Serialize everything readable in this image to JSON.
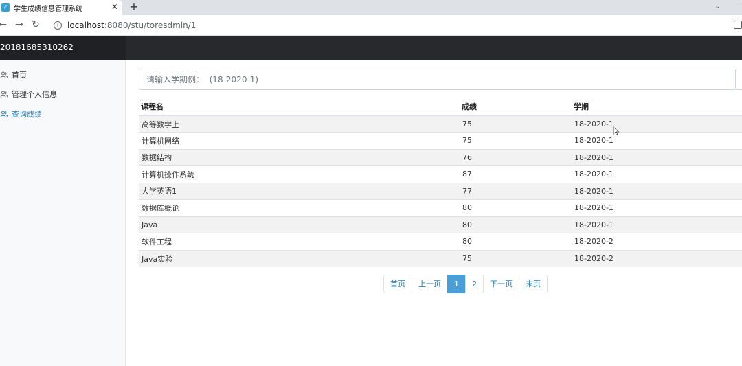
{
  "browser": {
    "tab_title": "学生成绩信息管理系统",
    "url_host": "localhost",
    "url_rest": ":8080/stu/toresdmin/1"
  },
  "app": {
    "brand": "20181685310262"
  },
  "sidebar": {
    "items": [
      {
        "label": "首页",
        "icon": "user-group-icon",
        "active": false
      },
      {
        "label": "管理个人信息",
        "icon": "user-group-icon",
        "active": false
      },
      {
        "label": "查询成绩",
        "icon": "user-group-icon",
        "active": true
      }
    ]
  },
  "search": {
    "placeholder": "请输入学期例：  (18-2020-1)"
  },
  "table": {
    "headers": [
      "课程名",
      "成绩",
      "学期"
    ],
    "rows": [
      [
        "高等数学上",
        "75",
        "18-2020-1"
      ],
      [
        "计算机网络",
        "75",
        "18-2020-1"
      ],
      [
        "数据结构",
        "76",
        "18-2020-1"
      ],
      [
        "计算机操作系统",
        "87",
        "18-2020-1"
      ],
      [
        "大学英语1",
        "77",
        "18-2020-1"
      ],
      [
        "数据库概论",
        "80",
        "18-2020-1"
      ],
      [
        "Java",
        "80",
        "18-2020-1"
      ],
      [
        "软件工程",
        "80",
        "18-2020-2"
      ],
      [
        "Java实验",
        "75",
        "18-2020-2"
      ]
    ]
  },
  "pagination": {
    "first": "首页",
    "prev": "上一页",
    "pages": [
      "1",
      "2"
    ],
    "current": "1",
    "next": "下一页",
    "last": "末页"
  },
  "colors": {
    "accent": "#2a7fb8",
    "navbar": "#27292c",
    "active_page": "#4a9fd8"
  }
}
